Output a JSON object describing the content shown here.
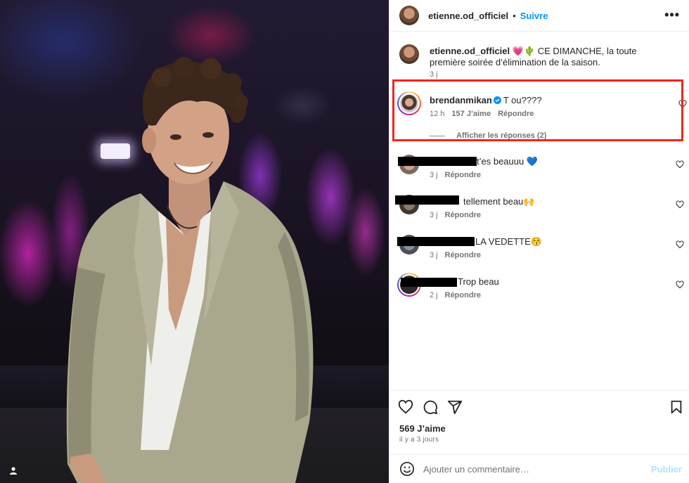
{
  "post": {
    "author": "etienne.od_officiel",
    "follow_label": "Suivre",
    "separator": "•",
    "more_label": "•••",
    "caption_text": "💗🌵 CE DIMANCHE, la toute première soirée d’élimination de la saison.",
    "caption_age": "3 j"
  },
  "highlighted_comment": {
    "author": "brendanmikan",
    "text": "T ou????",
    "age": "12 h",
    "likes": "157 J’aime",
    "reply_label": "Répondre",
    "show_replies": "Afficher les réponses (2)"
  },
  "comments": [
    {
      "text": "t’es beauuu 💙",
      "age": "3 j",
      "reply_label": "Répondre"
    },
    {
      "text": "tellement beau🙌",
      "age": "3 j",
      "reply_label": "Répondre"
    },
    {
      "text": "LA VEDETTE😚",
      "age": "3 j",
      "reply_label": "Répondre"
    },
    {
      "text": "Trop beau",
      "age": "2 j",
      "reply_label": "Répondre"
    }
  ],
  "footer": {
    "likes": "569 J’aime",
    "time": "il y a 3 jours",
    "comment_placeholder": "Ajouter un commentaire…",
    "publish_label": "Publier"
  },
  "colors": {
    "link_blue": "#0095f6",
    "highlight_red": "#f0261c",
    "muted": "#737373"
  },
  "icons": [
    "heart-icon",
    "comment-icon",
    "share-icon",
    "save-icon",
    "emoji-icon",
    "verified-icon",
    "more-icon",
    "user-icon"
  ]
}
